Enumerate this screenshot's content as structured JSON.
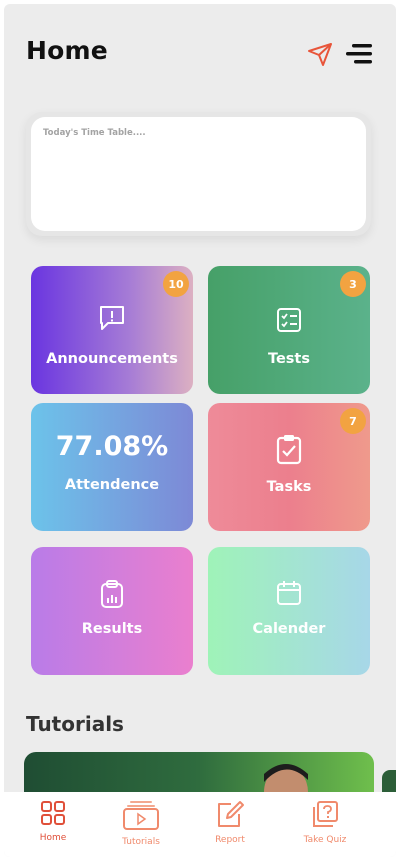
{
  "header": {
    "title": "Home"
  },
  "timetable": {
    "placeholder": "Today's Time Table...."
  },
  "tiles": {
    "announcements": {
      "label": "Announcements",
      "badge": "10"
    },
    "tests": {
      "label": "Tests",
      "badge": "3"
    },
    "attendance": {
      "value": "77.08%",
      "label": "Attendence"
    },
    "tasks": {
      "label": "Tasks",
      "badge": "7"
    },
    "results": {
      "label": "Results"
    },
    "calender": {
      "label": "Calender"
    }
  },
  "tutorials": {
    "title": "Tutorials"
  },
  "bottom_nav": {
    "items": [
      {
        "label": "Home",
        "icon": "grid-icon",
        "active": true
      },
      {
        "label": "Tutorials",
        "icon": "video-icon",
        "active": false
      },
      {
        "label": "Report",
        "icon": "edit-icon",
        "active": false
      },
      {
        "label": "Take Quiz",
        "icon": "quiz-icon",
        "active": false
      }
    ]
  },
  "colors": {
    "accent": "#e0503a",
    "badge": "#f2a341",
    "background": "#ececec"
  }
}
